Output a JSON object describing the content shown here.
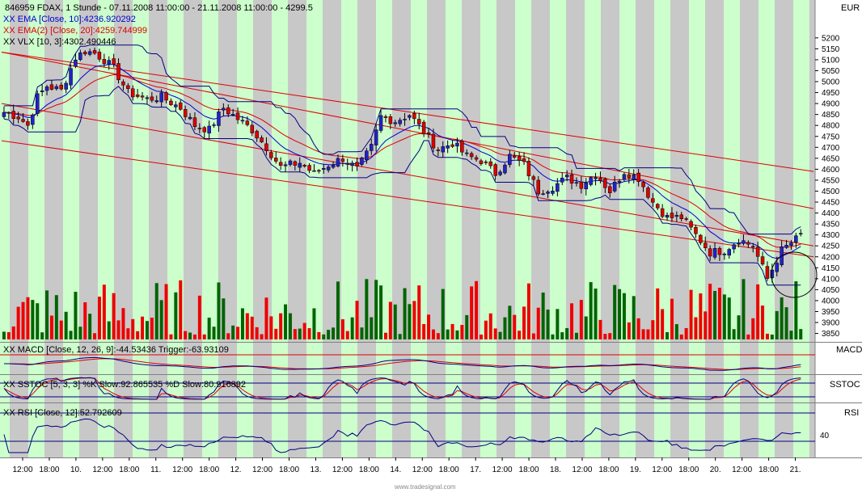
{
  "chart_data": {
    "type": "candlestick",
    "header": {
      "title": "846959 FDAX, 1 Stunde - 07.11.2008 11:00:00 - 21.11.2008 11:00:00 - 4299.5",
      "ema10": "EMA [Close, 10]:4236.920292",
      "ema20": "EMA(2) [Close, 20]:4259.744999",
      "vlx": "VLX [10, 3]:4302.490446"
    },
    "currency": "EUR",
    "price_axis": {
      "ticks": [
        "5200",
        "5150",
        "5100",
        "5050",
        "5000",
        "4950",
        "4900",
        "4850",
        "4800",
        "4750",
        "4700",
        "4650",
        "4600",
        "4550",
        "4500",
        "4450",
        "4400",
        "4350",
        "4300",
        "4250",
        "4200",
        "4150",
        "4100",
        "4050",
        "4000",
        "3950",
        "3900",
        "3850"
      ],
      "ylim": [
        3830,
        5240
      ]
    },
    "x_axis_labels": [
      "12:00",
      "18:00",
      "10.",
      "12:00",
      "18:00",
      "11.",
      "12:00",
      "18:00",
      "12.",
      "12:00",
      "18:00",
      "13.",
      "12:00",
      "18:00",
      "14.",
      "12:00",
      "18:00",
      "17.",
      "12:00",
      "18:00",
      "18.",
      "12:00",
      "18:00",
      "19.",
      "12:00",
      "18:00",
      "20.",
      "12:00",
      "18:00",
      "21."
    ],
    "close_anchors": [
      [
        0,
        4860
      ],
      [
        3,
        4840
      ],
      [
        5,
        4800
      ],
      [
        7,
        4930
      ],
      [
        9,
        4980
      ],
      [
        12,
        4960
      ],
      [
        15,
        5110
      ],
      [
        17,
        5140
      ],
      [
        19,
        5130
      ],
      [
        21,
        5100
      ],
      [
        23,
        5060
      ],
      [
        26,
        4950
      ],
      [
        30,
        4920
      ],
      [
        33,
        4930
      ],
      [
        37,
        4880
      ],
      [
        40,
        4800
      ],
      [
        43,
        4780
      ],
      [
        46,
        4880
      ],
      [
        49,
        4830
      ],
      [
        52,
        4780
      ],
      [
        55,
        4700
      ],
      [
        58,
        4610
      ],
      [
        62,
        4630
      ],
      [
        65,
        4580
      ],
      [
        68,
        4620
      ],
      [
        71,
        4650
      ],
      [
        74,
        4600
      ],
      [
        77,
        4700
      ],
      [
        79,
        4840
      ],
      [
        82,
        4820
      ],
      [
        85,
        4850
      ],
      [
        88,
        4770
      ],
      [
        91,
        4690
      ],
      [
        94,
        4720
      ],
      [
        97,
        4660
      ],
      [
        100,
        4640
      ],
      [
        103,
        4580
      ],
      [
        106,
        4660
      ],
      [
        109,
        4620
      ],
      [
        112,
        4500
      ],
      [
        115,
        4520
      ],
      [
        118,
        4560
      ],
      [
        121,
        4530
      ],
      [
        124,
        4580
      ],
      [
        127,
        4500
      ],
      [
        130,
        4590
      ],
      [
        133,
        4560
      ],
      [
        136,
        4450
      ],
      [
        139,
        4380
      ],
      [
        142,
        4380
      ],
      [
        145,
        4300
      ],
      [
        148,
        4220
      ],
      [
        151,
        4230
      ],
      [
        154,
        4280
      ],
      [
        157,
        4250
      ],
      [
        160,
        4100
      ],
      [
        163,
        4230
      ],
      [
        166,
        4280
      ],
      [
        167,
        4300
      ]
    ],
    "channels": [
      {
        "name": "upper",
        "from": 4900,
        "to": 4250
      },
      {
        "name": "mid",
        "from": 5135,
        "to": 4420
      },
      {
        "name": "upper-top",
        "from": 5135,
        "to": 4590
      },
      {
        "name": "lower",
        "from": 4730,
        "to": 4200
      }
    ],
    "macd": {
      "label": "MACD [Close, 12, 26, 9]:-44.53436 Trigger:-63.93109",
      "panel_name": "MACD"
    },
    "sstoc": {
      "label": "SSTOC [5, 3, 3] %K Slow:92.865535 %D Slow:80.916892",
      "panel_name": "SSTOC"
    },
    "rsi": {
      "label": "RSI [Close, 12]:52.792609",
      "panel_name": "RSI",
      "tick": "40"
    },
    "watermark": "www.tradesignal.com",
    "colors": {
      "up": "#2222cc",
      "down": "#dd0000",
      "vol_up": "#006400",
      "vol_down": "#ee0000",
      "ema10": "#0000cc",
      "ema20": "#dd0000",
      "band_green": "#ccffcc",
      "band_grey": "#c8c8c8"
    }
  }
}
